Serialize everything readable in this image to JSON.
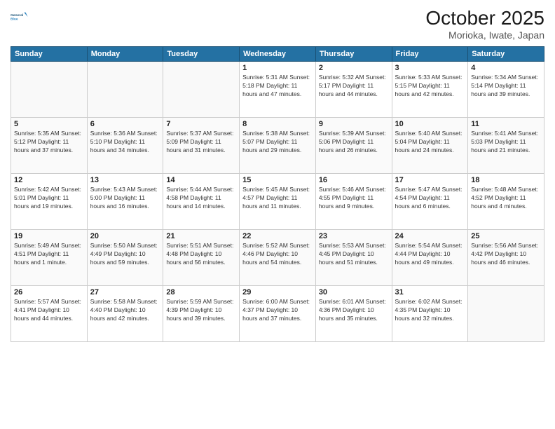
{
  "header": {
    "logo_line1": "General",
    "logo_line2": "Blue",
    "title": "October 2025",
    "location": "Morioka, Iwate, Japan"
  },
  "days_of_week": [
    "Sunday",
    "Monday",
    "Tuesday",
    "Wednesday",
    "Thursday",
    "Friday",
    "Saturday"
  ],
  "weeks": [
    [
      {
        "day": "",
        "info": ""
      },
      {
        "day": "",
        "info": ""
      },
      {
        "day": "",
        "info": ""
      },
      {
        "day": "1",
        "info": "Sunrise: 5:31 AM\nSunset: 5:18 PM\nDaylight: 11 hours\nand 47 minutes."
      },
      {
        "day": "2",
        "info": "Sunrise: 5:32 AM\nSunset: 5:17 PM\nDaylight: 11 hours\nand 44 minutes."
      },
      {
        "day": "3",
        "info": "Sunrise: 5:33 AM\nSunset: 5:15 PM\nDaylight: 11 hours\nand 42 minutes."
      },
      {
        "day": "4",
        "info": "Sunrise: 5:34 AM\nSunset: 5:14 PM\nDaylight: 11 hours\nand 39 minutes."
      }
    ],
    [
      {
        "day": "5",
        "info": "Sunrise: 5:35 AM\nSunset: 5:12 PM\nDaylight: 11 hours\nand 37 minutes."
      },
      {
        "day": "6",
        "info": "Sunrise: 5:36 AM\nSunset: 5:10 PM\nDaylight: 11 hours\nand 34 minutes."
      },
      {
        "day": "7",
        "info": "Sunrise: 5:37 AM\nSunset: 5:09 PM\nDaylight: 11 hours\nand 31 minutes."
      },
      {
        "day": "8",
        "info": "Sunrise: 5:38 AM\nSunset: 5:07 PM\nDaylight: 11 hours\nand 29 minutes."
      },
      {
        "day": "9",
        "info": "Sunrise: 5:39 AM\nSunset: 5:06 PM\nDaylight: 11 hours\nand 26 minutes."
      },
      {
        "day": "10",
        "info": "Sunrise: 5:40 AM\nSunset: 5:04 PM\nDaylight: 11 hours\nand 24 minutes."
      },
      {
        "day": "11",
        "info": "Sunrise: 5:41 AM\nSunset: 5:03 PM\nDaylight: 11 hours\nand 21 minutes."
      }
    ],
    [
      {
        "day": "12",
        "info": "Sunrise: 5:42 AM\nSunset: 5:01 PM\nDaylight: 11 hours\nand 19 minutes."
      },
      {
        "day": "13",
        "info": "Sunrise: 5:43 AM\nSunset: 5:00 PM\nDaylight: 11 hours\nand 16 minutes."
      },
      {
        "day": "14",
        "info": "Sunrise: 5:44 AM\nSunset: 4:58 PM\nDaylight: 11 hours\nand 14 minutes."
      },
      {
        "day": "15",
        "info": "Sunrise: 5:45 AM\nSunset: 4:57 PM\nDaylight: 11 hours\nand 11 minutes."
      },
      {
        "day": "16",
        "info": "Sunrise: 5:46 AM\nSunset: 4:55 PM\nDaylight: 11 hours\nand 9 minutes."
      },
      {
        "day": "17",
        "info": "Sunrise: 5:47 AM\nSunset: 4:54 PM\nDaylight: 11 hours\nand 6 minutes."
      },
      {
        "day": "18",
        "info": "Sunrise: 5:48 AM\nSunset: 4:52 PM\nDaylight: 11 hours\nand 4 minutes."
      }
    ],
    [
      {
        "day": "19",
        "info": "Sunrise: 5:49 AM\nSunset: 4:51 PM\nDaylight: 11 hours\nand 1 minute."
      },
      {
        "day": "20",
        "info": "Sunrise: 5:50 AM\nSunset: 4:49 PM\nDaylight: 10 hours\nand 59 minutes."
      },
      {
        "day": "21",
        "info": "Sunrise: 5:51 AM\nSunset: 4:48 PM\nDaylight: 10 hours\nand 56 minutes."
      },
      {
        "day": "22",
        "info": "Sunrise: 5:52 AM\nSunset: 4:46 PM\nDaylight: 10 hours\nand 54 minutes."
      },
      {
        "day": "23",
        "info": "Sunrise: 5:53 AM\nSunset: 4:45 PM\nDaylight: 10 hours\nand 51 minutes."
      },
      {
        "day": "24",
        "info": "Sunrise: 5:54 AM\nSunset: 4:44 PM\nDaylight: 10 hours\nand 49 minutes."
      },
      {
        "day": "25",
        "info": "Sunrise: 5:56 AM\nSunset: 4:42 PM\nDaylight: 10 hours\nand 46 minutes."
      }
    ],
    [
      {
        "day": "26",
        "info": "Sunrise: 5:57 AM\nSunset: 4:41 PM\nDaylight: 10 hours\nand 44 minutes."
      },
      {
        "day": "27",
        "info": "Sunrise: 5:58 AM\nSunset: 4:40 PM\nDaylight: 10 hours\nand 42 minutes."
      },
      {
        "day": "28",
        "info": "Sunrise: 5:59 AM\nSunset: 4:39 PM\nDaylight: 10 hours\nand 39 minutes."
      },
      {
        "day": "29",
        "info": "Sunrise: 6:00 AM\nSunset: 4:37 PM\nDaylight: 10 hours\nand 37 minutes."
      },
      {
        "day": "30",
        "info": "Sunrise: 6:01 AM\nSunset: 4:36 PM\nDaylight: 10 hours\nand 35 minutes."
      },
      {
        "day": "31",
        "info": "Sunrise: 6:02 AM\nSunset: 4:35 PM\nDaylight: 10 hours\nand 32 minutes."
      },
      {
        "day": "",
        "info": ""
      }
    ]
  ]
}
